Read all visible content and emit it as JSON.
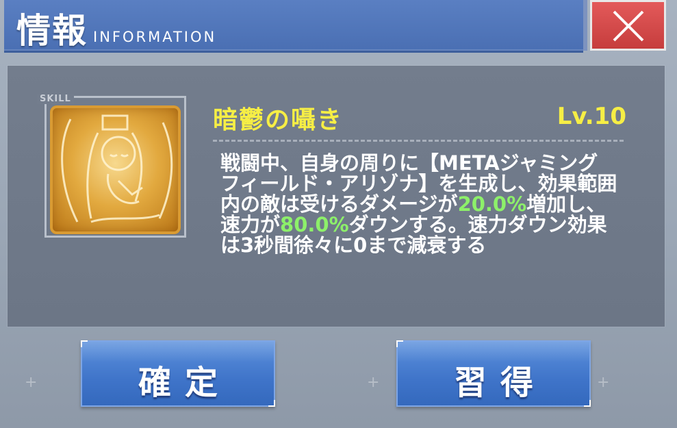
{
  "header": {
    "title_jp": "情報",
    "title_en": "INFORMATION",
    "close_icon": "close-x-icon"
  },
  "skill": {
    "tag": "SKILL",
    "icon": "skill-portrait-icon",
    "name": "暗鬱の囁き",
    "level": "Lv.10",
    "description": {
      "part1": "戦闘中、自身の周りに【METAジャミングフィールド・アリゾナ】を生成し、効果範囲内の敵は受けるダメージが",
      "value1": "20.0%",
      "part2": "増加し、速力が",
      "value2": "80.0%",
      "part3": "ダウンする。速力ダウン効果は3秒間徐々に0まで減衰する"
    }
  },
  "buttons": {
    "confirm": "確定",
    "learn": "習得"
  },
  "colors": {
    "accent_yellow": "#f6ee45",
    "highlight_green": "#8df06a",
    "header_blue": "#4a6fb3",
    "close_red": "#c63d3d"
  }
}
